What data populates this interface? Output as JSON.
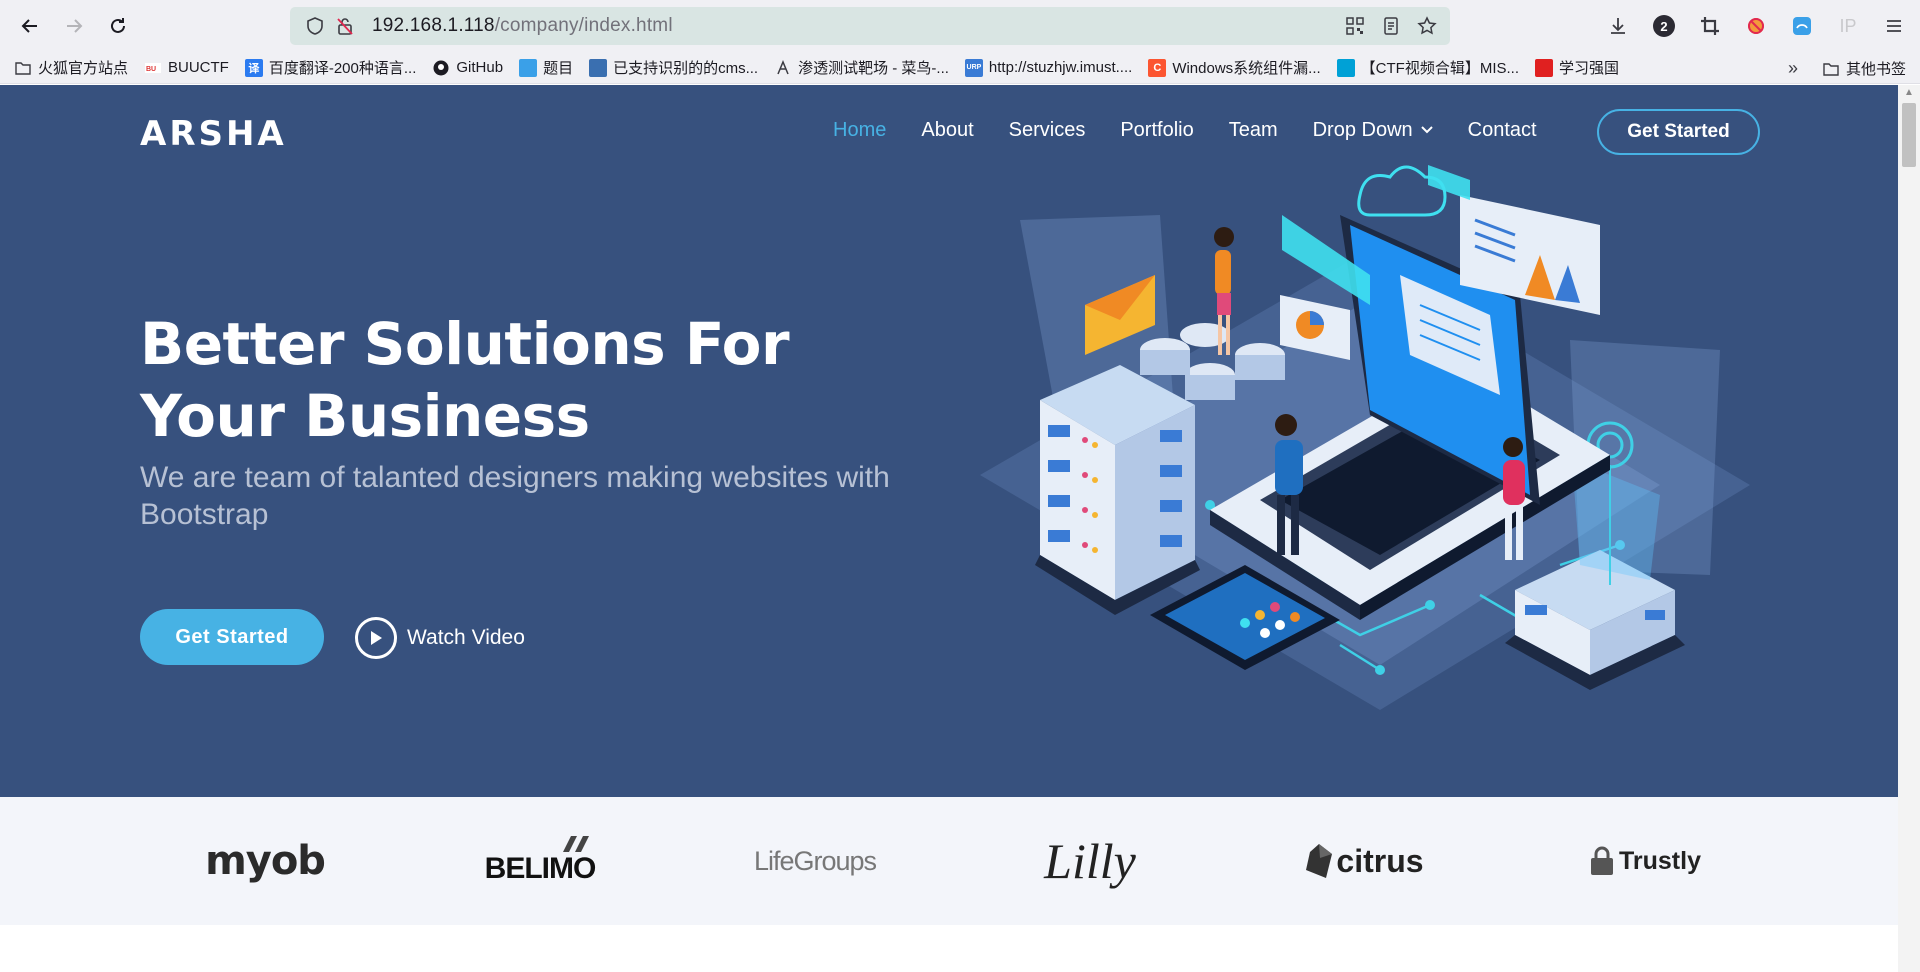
{
  "browser": {
    "url_host": "192.168.1.118",
    "url_path": "/company/index.html",
    "downloads_badge": "2",
    "ext_ip_label": "IP"
  },
  "bookmarks": [
    {
      "label": "火狐官方站点",
      "icon": "folder-icon"
    },
    {
      "label": "BUUCTF",
      "icon": "buuctf-icon",
      "color": "#d33"
    },
    {
      "label": "百度翻译-200种语言...",
      "icon": "translate-icon",
      "color": "#2b7bf0",
      "glyph": "译"
    },
    {
      "label": "GitHub",
      "icon": "github-icon"
    },
    {
      "label": "题目",
      "icon": "tiku-icon",
      "color": "#3aa0e8"
    },
    {
      "label": "已支持识别的的cms...",
      "icon": "python-icon",
      "color": "#3a6fb0"
    },
    {
      "label": "渗透测试靶场 - 菜鸟-...",
      "icon": "cainiao-icon"
    },
    {
      "label": "http://stuzhjw.imust....",
      "icon": "urp-icon",
      "color": "#3a7bd5",
      "glyph": "URP"
    },
    {
      "label": "Windows系统组件漏...",
      "icon": "csdn-icon",
      "color": "#fc5531",
      "glyph": "C"
    },
    {
      "label": "【CTF视频合辑】MIS...",
      "icon": "bilibili-icon",
      "color": "#00a1d6"
    },
    {
      "label": "学习强国",
      "icon": "xuexi-icon",
      "color": "#e02020"
    }
  ],
  "bookmarks_other": "其他书签",
  "site": {
    "logo": "ARSHA",
    "nav": [
      {
        "label": "Home",
        "active": true
      },
      {
        "label": "About"
      },
      {
        "label": "Services"
      },
      {
        "label": "Portfolio"
      },
      {
        "label": "Team"
      },
      {
        "label": "Drop Down",
        "dropdown": true
      },
      {
        "label": "Contact"
      }
    ],
    "nav_cta": "Get Started",
    "hero_title": "Better Solutions For Your Business",
    "hero_subtitle": "We are team of talanted designers making websites with Bootstrap",
    "hero_cta": "Get Started",
    "watch_video": "Watch Video",
    "clients": [
      "myob",
      "BELIMO",
      "LifeGroups",
      "Lilly",
      "citrus",
      "Trustly"
    ]
  },
  "colors": {
    "hero_bg": "#37517e",
    "accent": "#47b2e4",
    "clients_bg": "#f3f5fa"
  }
}
